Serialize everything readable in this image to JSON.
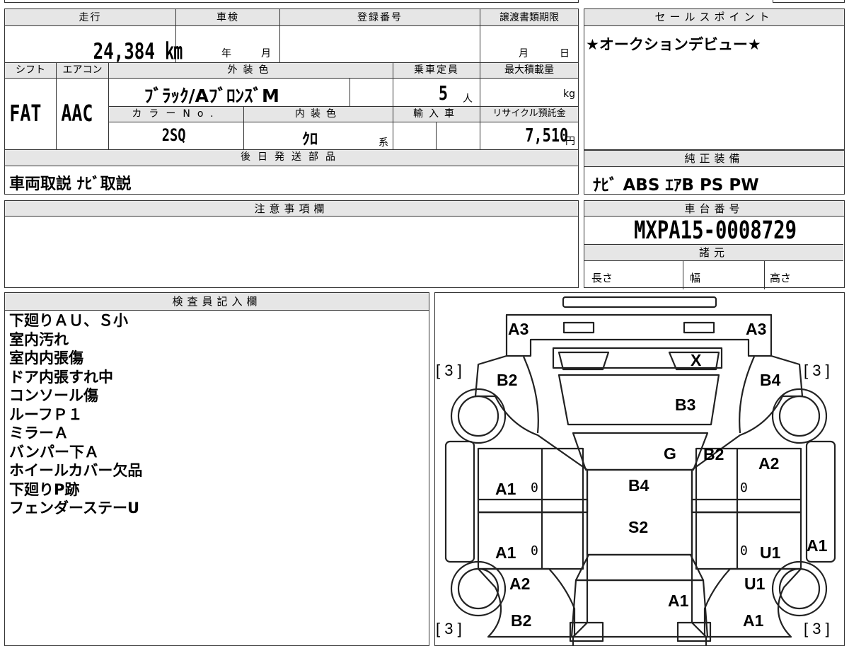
{
  "spec": {
    "mileage_label": "走行",
    "mileage_value": "24,384 ㎞",
    "inspection_label": "車検",
    "inspection_year": "年",
    "inspection_month": "月",
    "registration_label": "登録番号",
    "transfer_label": "譲渡書類期限",
    "transfer_month": "月",
    "transfer_day": "日",
    "shift_label": "シフト",
    "shift_value": "FAT",
    "ac_label": "エアコン",
    "ac_value": "AAC",
    "exterior_label": "外装色",
    "exterior_value": "ﾌﾞﾗｯｸ/AﾌﾞﾛﾝｽﾞM",
    "capacity_label": "乗車定員",
    "capacity_value": "5",
    "capacity_unit": "人",
    "loadcap_label": "最大積載量",
    "loadcap_unit": "kg",
    "color_no_label": "カラーNo.",
    "color_no_value": "2SQ",
    "interior_label": "内装色",
    "interior_value": "ｸﾛ",
    "interior_suffix": "系",
    "import_label": "輸入車",
    "recycle_label": "リサイクル預託金",
    "recycle_value": "7,510",
    "recycle_unit": "円",
    "later_parts_label": "後日発送部品",
    "later_parts_value": "車両取説 ﾅﾋﾞ取説"
  },
  "sales": {
    "label": "セールスポイント",
    "text": "★オークションデビュー★"
  },
  "equipment": {
    "label": "純正装備",
    "text": "ﾅﾋﾞ ABS ｴｱB PS PW"
  },
  "caution": {
    "label": "注意事項欄"
  },
  "chassis": {
    "label": "車台番号",
    "value": "MXPA15-0008729",
    "dims_label": "諸元",
    "length": "長さ",
    "width": "幅",
    "height": "高さ"
  },
  "inspector": {
    "label": "検査員記入欄",
    "lines": [
      "下廻りＡＵ、Ｓ小",
      "室内汚れ",
      "室内内張傷",
      "ドア内張すれ中",
      "コンソール傷",
      "ルーフＰ１",
      "ミラーＡ",
      "バンパー下Ａ",
      "ホイールカバー欠品",
      "下廻りP跡",
      "フェンダーステーU"
    ]
  },
  "diagram": {
    "front_left": "A3",
    "front_right": "A3",
    "windshield": "X",
    "hood": "B3",
    "cowl": "G",
    "cowl_right": "B2",
    "roof": "B4",
    "rear_roof": "S2",
    "trunk": "A1",
    "fender_fl": "B2",
    "fender_fr": "B4",
    "door_fl": "A1",
    "door_rl": "A1",
    "door_fr": "A2",
    "door_rr": "U1",
    "sill_r": "A1",
    "qtr_rl": "A2",
    "qtr_rr": "U1",
    "rear_l": "B2",
    "rear_r": "A1",
    "tire_tl": "[ 3 ]",
    "tire_tr": "[ 3 ]",
    "tire_bl": "[ 3 ]",
    "tire_br": "[ 3 ]",
    "zero": "0"
  }
}
